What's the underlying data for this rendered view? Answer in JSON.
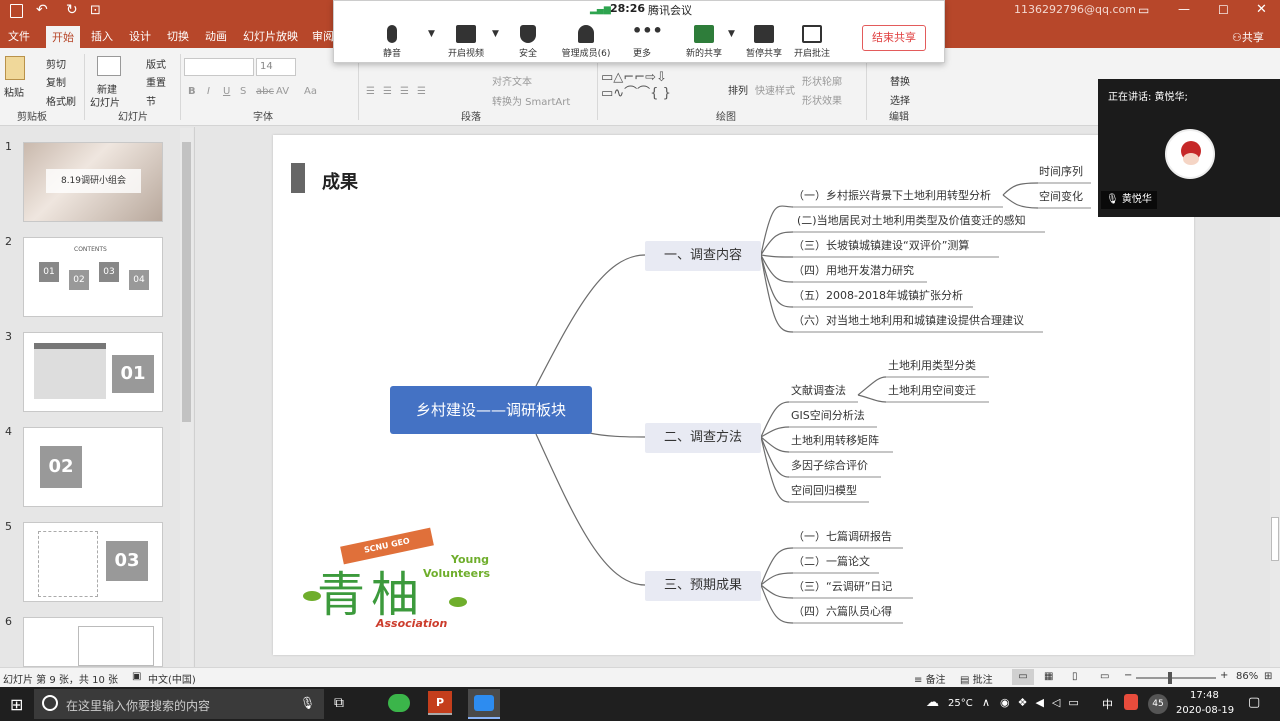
{
  "titlebar": {
    "account": "1136292796@qq.com"
  },
  "tabs": [
    "文件",
    "开始",
    "插入",
    "设计",
    "切换",
    "动画",
    "幻灯片放映",
    "审阅"
  ],
  "active_tab": "开始",
  "share_label": "共享",
  "ribbon": {
    "clipboard": {
      "paste": "粘贴",
      "cut": "剪切",
      "copy": "复制",
      "format_painter": "格式刷",
      "group": "剪贴板"
    },
    "slides": {
      "new_slide": "新建",
      "new_slide2": "幻灯片",
      "layout": "版式",
      "reset": "重置",
      "section": "节",
      "group": "幻灯片"
    },
    "font": {
      "font_size": "14",
      "bold": "B",
      "italic": "I",
      "underline": "U",
      "shadow": "S",
      "strike": "abc",
      "spacing": "AV",
      "case": "Aa",
      "group": "字体"
    },
    "paragraph": {
      "text_direction": "文字方向",
      "align_text": "对齐文本",
      "smartart": "转换为 SmartArt",
      "group": "段落"
    },
    "drawing": {
      "arrange": "排列",
      "quick_styles": "快速样式",
      "shape_fill": "形状填充",
      "shape_outline": "形状轮廓",
      "shape_effects": "形状效果",
      "group": "绘图"
    },
    "editing": {
      "replace": "替换",
      "select": "选择",
      "group": "编辑"
    }
  },
  "meeting": {
    "time": "28:26",
    "app": "腾讯会议",
    "buttons": [
      "静音",
      "开启视频",
      "安全",
      "管理成员(6)",
      "更多",
      "新的共享",
      "暂停共享",
      "开启批注"
    ],
    "end_share": "结束共享"
  },
  "video": {
    "speaking_label": "正在讲话: 黄悦华;",
    "name": "黄悦华"
  },
  "thumbnails": [
    {
      "num": "1",
      "title": "8.19调研小组会"
    },
    {
      "num": "2",
      "title": "CONTENTS",
      "items": [
        "01",
        "02",
        "03",
        "04"
      ]
    },
    {
      "num": "3",
      "badge": "01"
    },
    {
      "num": "4",
      "badge": "02"
    },
    {
      "num": "5",
      "badge": "03"
    },
    {
      "num": "6"
    }
  ],
  "slide": {
    "title": "成果",
    "central": "乡村建设——调研板块",
    "branches": [
      {
        "label": "一、调查内容",
        "leaves": [
          "（一）乡村振兴背景下土地利用转型分析",
          "(二)当地居民对土地利用类型及价值变迁的感知",
          "（三）长坡镇城镇建设“双评价”测算",
          "（四）用地开发潜力研究",
          "（五）2008-2018年城镇扩张分析",
          "（六）对当地土地利用和城镇建设提供合理建议"
        ],
        "sub": [
          "时间序列",
          "空间变化"
        ]
      },
      {
        "label": "二、调查方法",
        "leaves": [
          "文献调查法",
          "GIS空间分析法",
          "土地利用转移矩阵",
          "多因子综合评价",
          "空间回归模型"
        ],
        "sub": [
          "土地利用类型分类",
          "土地利用空间变迁"
        ]
      },
      {
        "label": "三、预期成果",
        "leaves": [
          "（一）七篇调研报告",
          "（二）一篇论文",
          "（三）“云调研”日记",
          "（四）六篇队员心得"
        ]
      }
    ],
    "logo": {
      "banner": "SCNU GEO",
      "line1": "Young",
      "line2": "Volunteers",
      "line3": "Association",
      "chars": "青柚"
    }
  },
  "statusbar": {
    "slide_info": "幻灯片 第 9 张，共 10 张",
    "language": "中文(中国)",
    "notes": "备注",
    "comments": "批注",
    "zoom": "86%"
  },
  "taskbar": {
    "search_placeholder": "在这里输入你要搜索的内容",
    "temp": "25°C",
    "ime": "中",
    "badge": "45",
    "time": "17:48",
    "date": "2020-08-19"
  },
  "colors": {
    "accent": "#b7472a",
    "node_blue": "#4472c4",
    "node_fill": "#e8eaf3",
    "line": "#6c6c6c"
  }
}
